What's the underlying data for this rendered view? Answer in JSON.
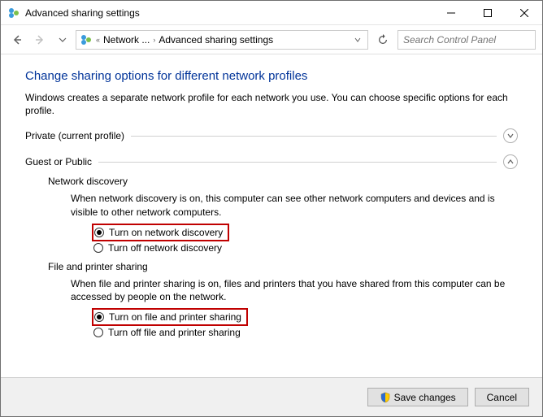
{
  "window": {
    "title": "Advanced sharing settings"
  },
  "breadcrumb": {
    "seg1": "Network ...",
    "seg2": "Advanced sharing settings"
  },
  "search": {
    "placeholder": "Search Control Panel"
  },
  "main": {
    "heading": "Change sharing options for different network profiles",
    "description": "Windows creates a separate network profile for each network you use. You can choose specific options for each profile."
  },
  "sections": {
    "private": {
      "label": "Private (current profile)"
    },
    "guest": {
      "label": "Guest or Public",
      "groups": {
        "discovery": {
          "title": "Network discovery",
          "desc": "When network discovery is on, this computer can see other network computers and devices and is visible to other network computers.",
          "on": "Turn on network discovery",
          "off": "Turn off network discovery"
        },
        "fileprint": {
          "title": "File and printer sharing",
          "desc": "When file and printer sharing is on, files and printers that you have shared from this computer can be accessed by people on the network.",
          "on": "Turn on file and printer sharing",
          "off": "Turn off file and printer sharing"
        }
      }
    }
  },
  "footer": {
    "save": "Save changes",
    "cancel": "Cancel"
  }
}
